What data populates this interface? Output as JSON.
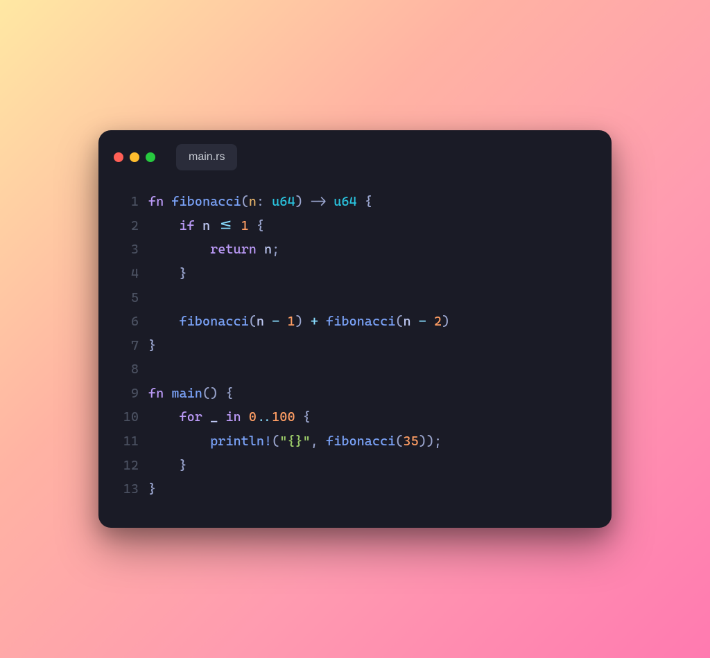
{
  "window": {
    "tab_title": "main.rs",
    "traffic_lights": [
      "close",
      "minimize",
      "zoom"
    ]
  },
  "code": {
    "language": "rust",
    "lines": [
      {
        "n": 1,
        "tokens": [
          [
            "keyword",
            "fn"
          ],
          [
            "plain",
            " "
          ],
          [
            "func",
            "fibonacci"
          ],
          [
            "punct",
            "("
          ],
          [
            "param",
            "n"
          ],
          [
            "punct",
            ":"
          ],
          [
            "plain",
            " "
          ],
          [
            "type",
            "u64"
          ],
          [
            "punct",
            ")"
          ],
          [
            "plain",
            " "
          ],
          [
            "punct",
            "->"
          ],
          [
            "plain",
            " "
          ],
          [
            "type",
            "u64"
          ],
          [
            "plain",
            " "
          ],
          [
            "brace",
            "{"
          ]
        ]
      },
      {
        "n": 2,
        "tokens": [
          [
            "plain",
            "    "
          ],
          [
            "keyword",
            "if"
          ],
          [
            "plain",
            " "
          ],
          [
            "ident",
            "n"
          ],
          [
            "plain",
            " "
          ],
          [
            "op",
            "<="
          ],
          [
            "plain",
            " "
          ],
          [
            "number",
            "1"
          ],
          [
            "plain",
            " "
          ],
          [
            "brace",
            "{"
          ]
        ]
      },
      {
        "n": 3,
        "tokens": [
          [
            "plain",
            "        "
          ],
          [
            "keyword",
            "return"
          ],
          [
            "plain",
            " "
          ],
          [
            "ident",
            "n"
          ],
          [
            "punct",
            ";"
          ]
        ]
      },
      {
        "n": 4,
        "tokens": [
          [
            "plain",
            "    "
          ],
          [
            "brace",
            "}"
          ]
        ]
      },
      {
        "n": 5,
        "tokens": []
      },
      {
        "n": 6,
        "tokens": [
          [
            "plain",
            "    "
          ],
          [
            "func",
            "fibonacci"
          ],
          [
            "punct",
            "("
          ],
          [
            "ident",
            "n"
          ],
          [
            "plain",
            " "
          ],
          [
            "op",
            "-"
          ],
          [
            "plain",
            " "
          ],
          [
            "number",
            "1"
          ],
          [
            "punct",
            ")"
          ],
          [
            "plain",
            " "
          ],
          [
            "op",
            "+"
          ],
          [
            "plain",
            " "
          ],
          [
            "func",
            "fibonacci"
          ],
          [
            "punct",
            "("
          ],
          [
            "ident",
            "n"
          ],
          [
            "plain",
            " "
          ],
          [
            "op",
            "-"
          ],
          [
            "plain",
            " "
          ],
          [
            "number",
            "2"
          ],
          [
            "punct",
            ")"
          ]
        ]
      },
      {
        "n": 7,
        "tokens": [
          [
            "brace",
            "}"
          ]
        ]
      },
      {
        "n": 8,
        "tokens": []
      },
      {
        "n": 9,
        "tokens": [
          [
            "keyword",
            "fn"
          ],
          [
            "plain",
            " "
          ],
          [
            "func",
            "main"
          ],
          [
            "punct",
            "("
          ],
          [
            "punct",
            ")"
          ],
          [
            "plain",
            " "
          ],
          [
            "brace",
            "{"
          ]
        ]
      },
      {
        "n": 10,
        "tokens": [
          [
            "plain",
            "    "
          ],
          [
            "keyword",
            "for"
          ],
          [
            "plain",
            " "
          ],
          [
            "ident",
            "_"
          ],
          [
            "plain",
            " "
          ],
          [
            "keyword",
            "in"
          ],
          [
            "plain",
            " "
          ],
          [
            "number",
            "0"
          ],
          [
            "op",
            ".."
          ],
          [
            "number",
            "100"
          ],
          [
            "plain",
            " "
          ],
          [
            "brace",
            "{"
          ]
        ]
      },
      {
        "n": 11,
        "tokens": [
          [
            "plain",
            "        "
          ],
          [
            "macro",
            "println!"
          ],
          [
            "punct",
            "("
          ],
          [
            "string",
            "\"{}\""
          ],
          [
            "punct",
            ","
          ],
          [
            "plain",
            " "
          ],
          [
            "func",
            "fibonacci"
          ],
          [
            "punct",
            "("
          ],
          [
            "number",
            "35"
          ],
          [
            "punct",
            ")"
          ],
          [
            "punct",
            ")"
          ],
          [
            "punct",
            ";"
          ]
        ]
      },
      {
        "n": 12,
        "tokens": [
          [
            "plain",
            "    "
          ],
          [
            "brace",
            "}"
          ]
        ]
      },
      {
        "n": 13,
        "tokens": [
          [
            "brace",
            "}"
          ]
        ]
      }
    ]
  }
}
